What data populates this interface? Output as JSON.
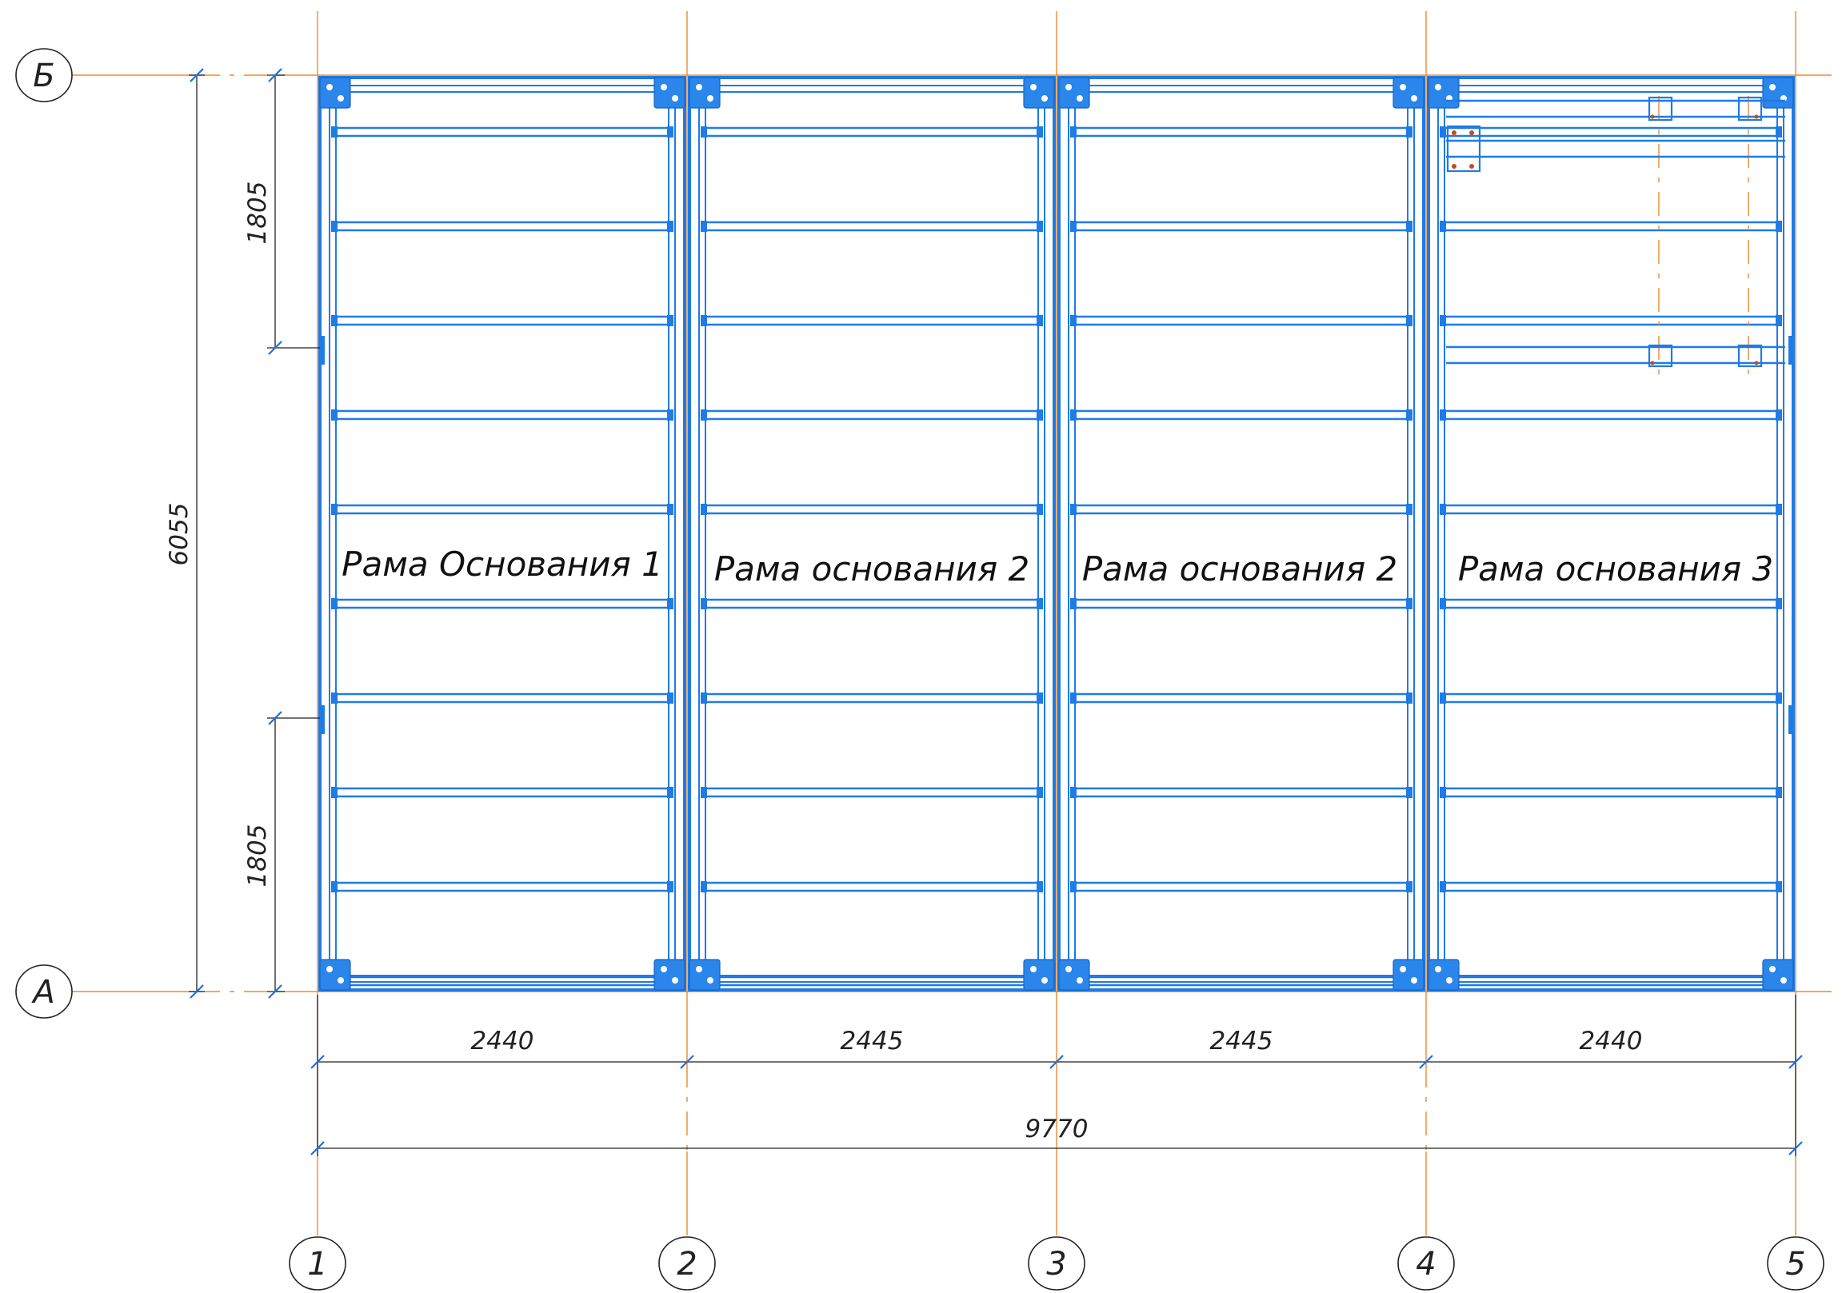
{
  "axes": {
    "columns": [
      "1",
      "2",
      "3",
      "4",
      "5"
    ],
    "rows": [
      "Б",
      "А"
    ]
  },
  "frames": [
    {
      "label": "Рама Основания 1"
    },
    {
      "label": "Рама основания 2"
    },
    {
      "label": "Рама основания 2"
    },
    {
      "label": "Рама основания 3"
    }
  ],
  "dimensions": {
    "spans": [
      "2440",
      "2445",
      "2445",
      "2440"
    ],
    "total": "9770",
    "height": "6055",
    "side_top": "1805",
    "side_bottom": "1805"
  },
  "colors": {
    "steel": "#1f7be6",
    "axis": "#f0882a",
    "ink": "#222222"
  }
}
